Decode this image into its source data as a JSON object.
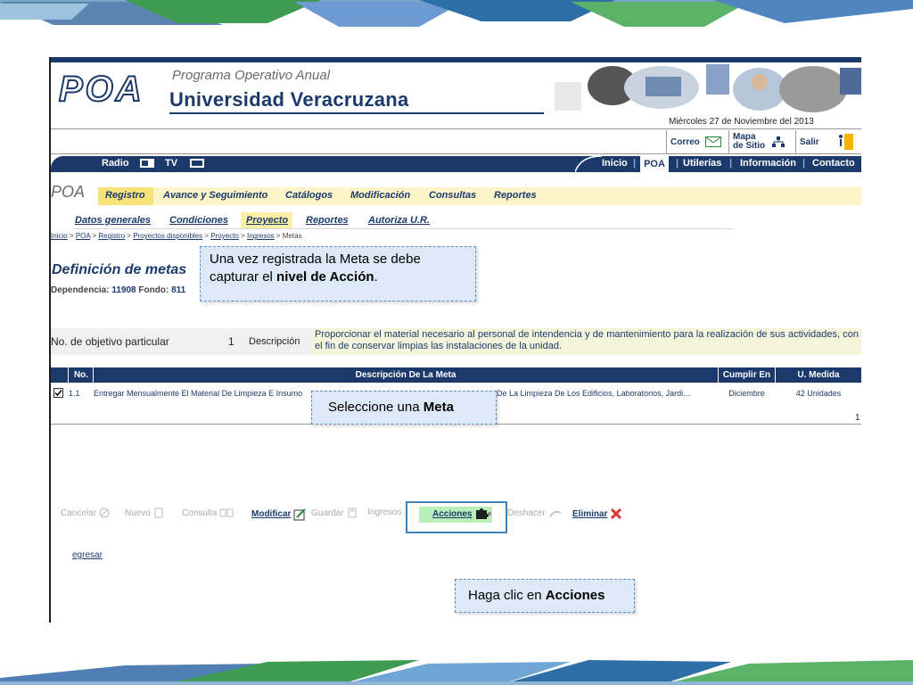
{
  "header": {
    "logo": "POA",
    "program_title": "Programa Operativo Anual",
    "university": "Universidad Veracruzana",
    "date": "Miércoles 27 de Noviembre del 2013"
  },
  "utilities": {
    "correo": "Correo",
    "mapa_line1": "Mapa",
    "mapa_line2": "de Sitio",
    "salir": "Salir"
  },
  "navbar": {
    "radio": "Radio",
    "tv": "TV",
    "items": [
      "Inicio",
      "POA",
      "Utilerías",
      "Información",
      "Contacto"
    ],
    "separator": "|"
  },
  "menu": {
    "section": "POA",
    "items": [
      "Registro",
      "Avance y Seguimiento",
      "Catálogos",
      "Modificación",
      "Consultas",
      "Reportes"
    ]
  },
  "submenu": {
    "items": [
      "Datos generales",
      "Condiciones",
      "Proyecto",
      "Reportes",
      "Autoriza U.R."
    ]
  },
  "breadcrumb": {
    "links": [
      "Inicio",
      "POA",
      "Registro",
      "Proyectos disponibles",
      "Proyecto",
      "Ingresos"
    ],
    "current": "Metas",
    "sep": " > "
  },
  "page": {
    "title": "Definición de metas",
    "dependencia_label": "Dependencia:",
    "dependencia_value": "11908",
    "fondo_label": "Fondo:",
    "fondo_value": "811"
  },
  "objective": {
    "label": "No. de objetivo particular",
    "number": "1",
    "desc_label": "Descripción",
    "description": "Proporcionar el material necesario al personal de intendencia y de mantenimiento para la realización de sus actividades, con el fin de conservar limpias las instalaciones de la unidad."
  },
  "table": {
    "headers": [
      "No.",
      "Descripción De La Meta",
      "Cumplir En",
      "U. Medida"
    ],
    "rows": [
      {
        "no": "1.1",
        "desc_left": "Entregar Mensualmente El Material De Limpieza E Insumo",
        "desc_right": "De La Limpieza De Los Edificios, Laboratorios, Jardi...",
        "cumplir": "Diciembre",
        "medida": "42 Unidades"
      }
    ],
    "page": "1"
  },
  "buttons": {
    "cancelar": "Cancelar",
    "nuevo": "Nuevo",
    "consulta": "Consulta",
    "modificar": "Modificar",
    "guardar": "Guardar",
    "ingresos": "Ingresos",
    "acciones": "Acciones",
    "deshacer": "Deshacer",
    "eliminar": "Eliminar"
  },
  "regresar": "egresar",
  "callouts": {
    "c1_pre": "Una vez registrada la Meta se debe capturar el ",
    "c1_bold": "nivel de Acción",
    "c1_post": ".",
    "c2_pre": "Seleccione una ",
    "c2_bold": "Meta",
    "c3_pre": "Haga clic en ",
    "c3_bold": "Acciones"
  },
  "colors": {
    "primary": "#1b3a6b",
    "menu_bg": "#fdf5c8",
    "callout_bg": "#dde9f7",
    "acciones_bg": "#b9f0b9"
  }
}
